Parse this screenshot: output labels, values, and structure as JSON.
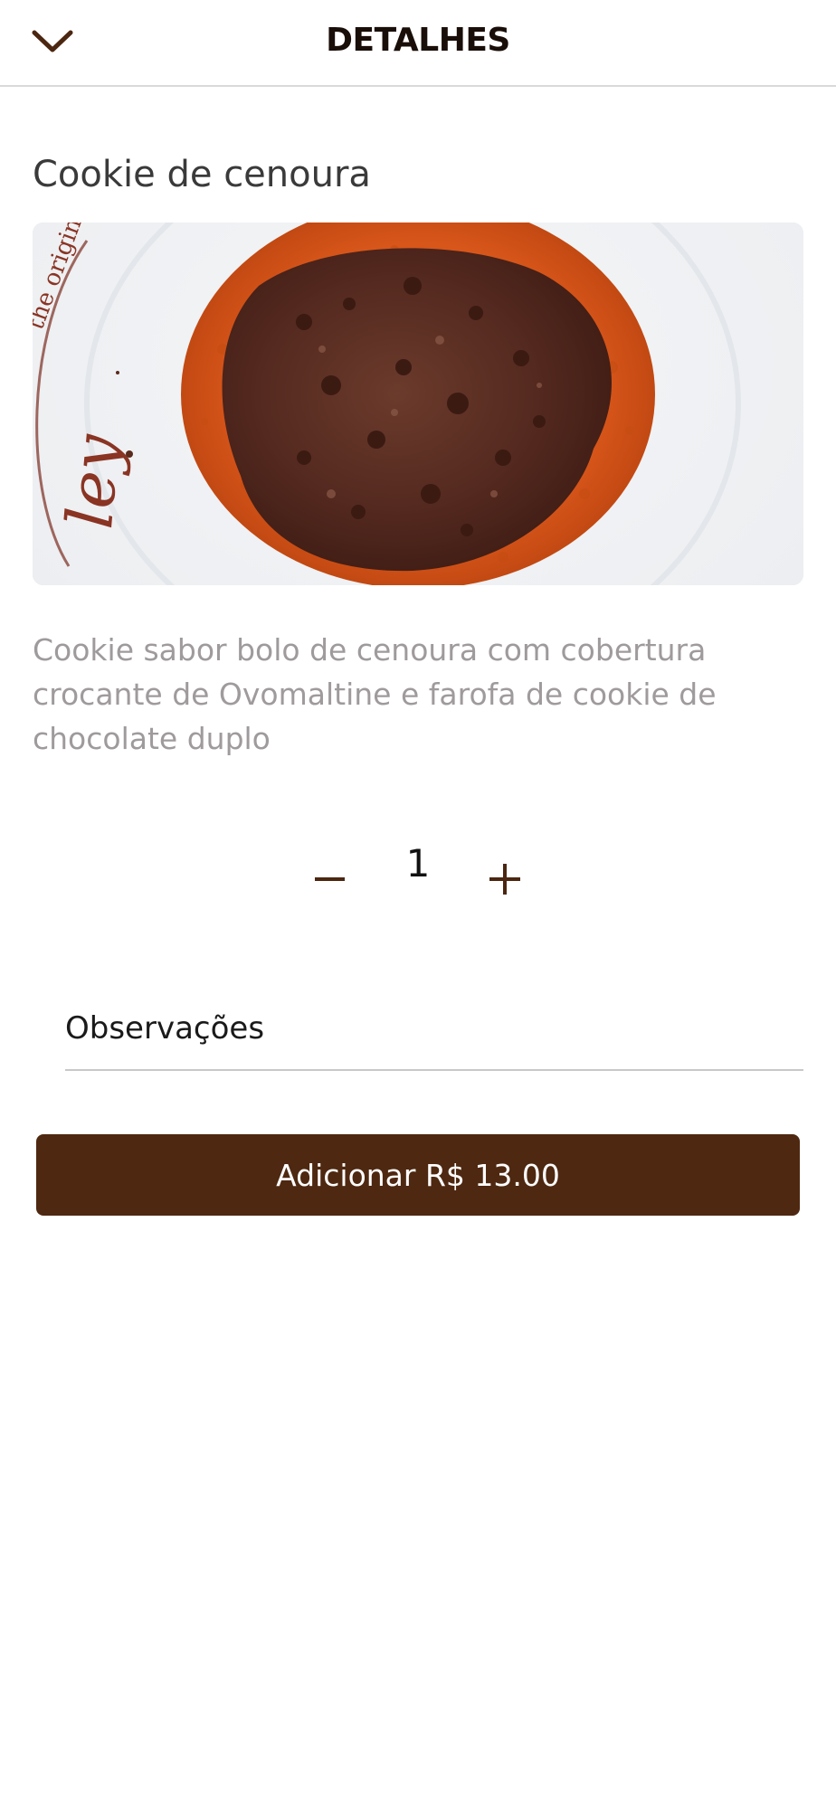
{
  "header": {
    "title": "DETALHES",
    "back_icon": "chevron-down-icon"
  },
  "product": {
    "name": "Cookie de cenoura",
    "image_plate_text": "the original",
    "description": "Cookie sabor bolo de cenoura com cobertura crocante de Ovomaltine e farofa de cookie de chocolate duplo"
  },
  "quantity": {
    "value": "1",
    "minus_icon": "minus-icon",
    "plus_icon": "plus-icon"
  },
  "observations": {
    "placeholder": "Observações",
    "value": ""
  },
  "add_button": {
    "label": "Adicionar R$ 13.00"
  },
  "colors": {
    "brand_brown": "#4e2810",
    "icon_brown": "#4b2611",
    "title_text": "#1a0e08",
    "description_text": "#9f9a9c",
    "divider": "#d9d9d9"
  }
}
